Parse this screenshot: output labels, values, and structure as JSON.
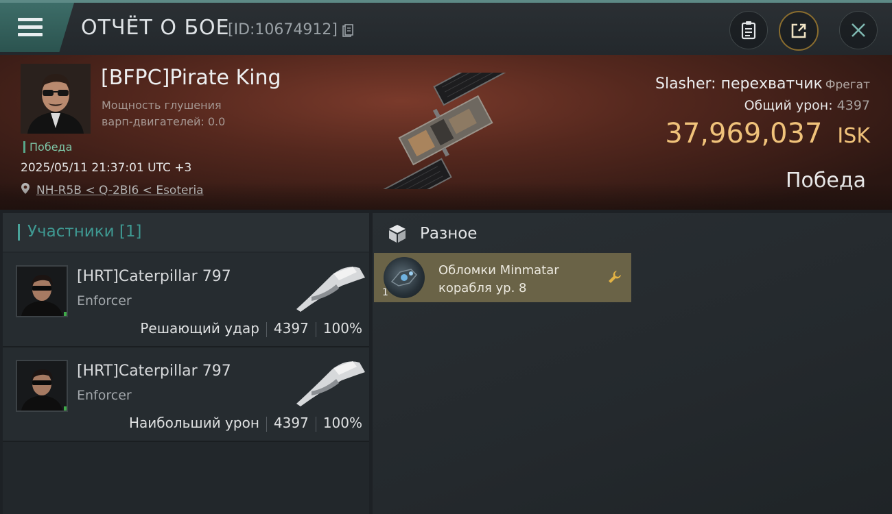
{
  "header": {
    "title": "ОТЧЁТ О БОЕ",
    "report_id": "[ID:10674912]",
    "buttons": [
      "clipboard-icon",
      "share-icon",
      "close-icon"
    ]
  },
  "victim": {
    "name": "[BFPC]Pirate King",
    "stat_line1": "Мощность глушения",
    "stat_line2": "варп-двигателей: 0.0",
    "tag": "Победа",
    "time": "2025/05/11 21:37:01 UTC +3",
    "location": "NH-R5B < Q-2BI6 < Esoteria",
    "ship": "Slasher: перехватчик",
    "ship_class": "Фрегат",
    "damage_label": "Общий урон:",
    "damage_value": "4397",
    "isk_value": "37,969,037",
    "isk_unit": "ISK",
    "result": "Победа"
  },
  "participants": {
    "title": "Участники [1]",
    "rows": [
      {
        "name": "[HRT]Caterpillar 797",
        "ship": "Enforcer",
        "role": "Решающий удар",
        "damage": "4397",
        "percent": "100%"
      },
      {
        "name": "[HRT]Caterpillar 797",
        "ship": "Enforcer",
        "role": "Наибольший урон",
        "damage": "4397",
        "percent": "100%"
      }
    ]
  },
  "misc": {
    "title": "Разное",
    "items": [
      {
        "line1": "Обломки Minmatar",
        "line2": "корабля ур. 8",
        "count": "1",
        "icon": "wrench-icon"
      }
    ]
  },
  "colors": {
    "accent_teal": "#4aa39a",
    "isk_gold": "#f0c27a",
    "victory_green": "#7ec7a8",
    "loot_bg": "#6a6347"
  }
}
